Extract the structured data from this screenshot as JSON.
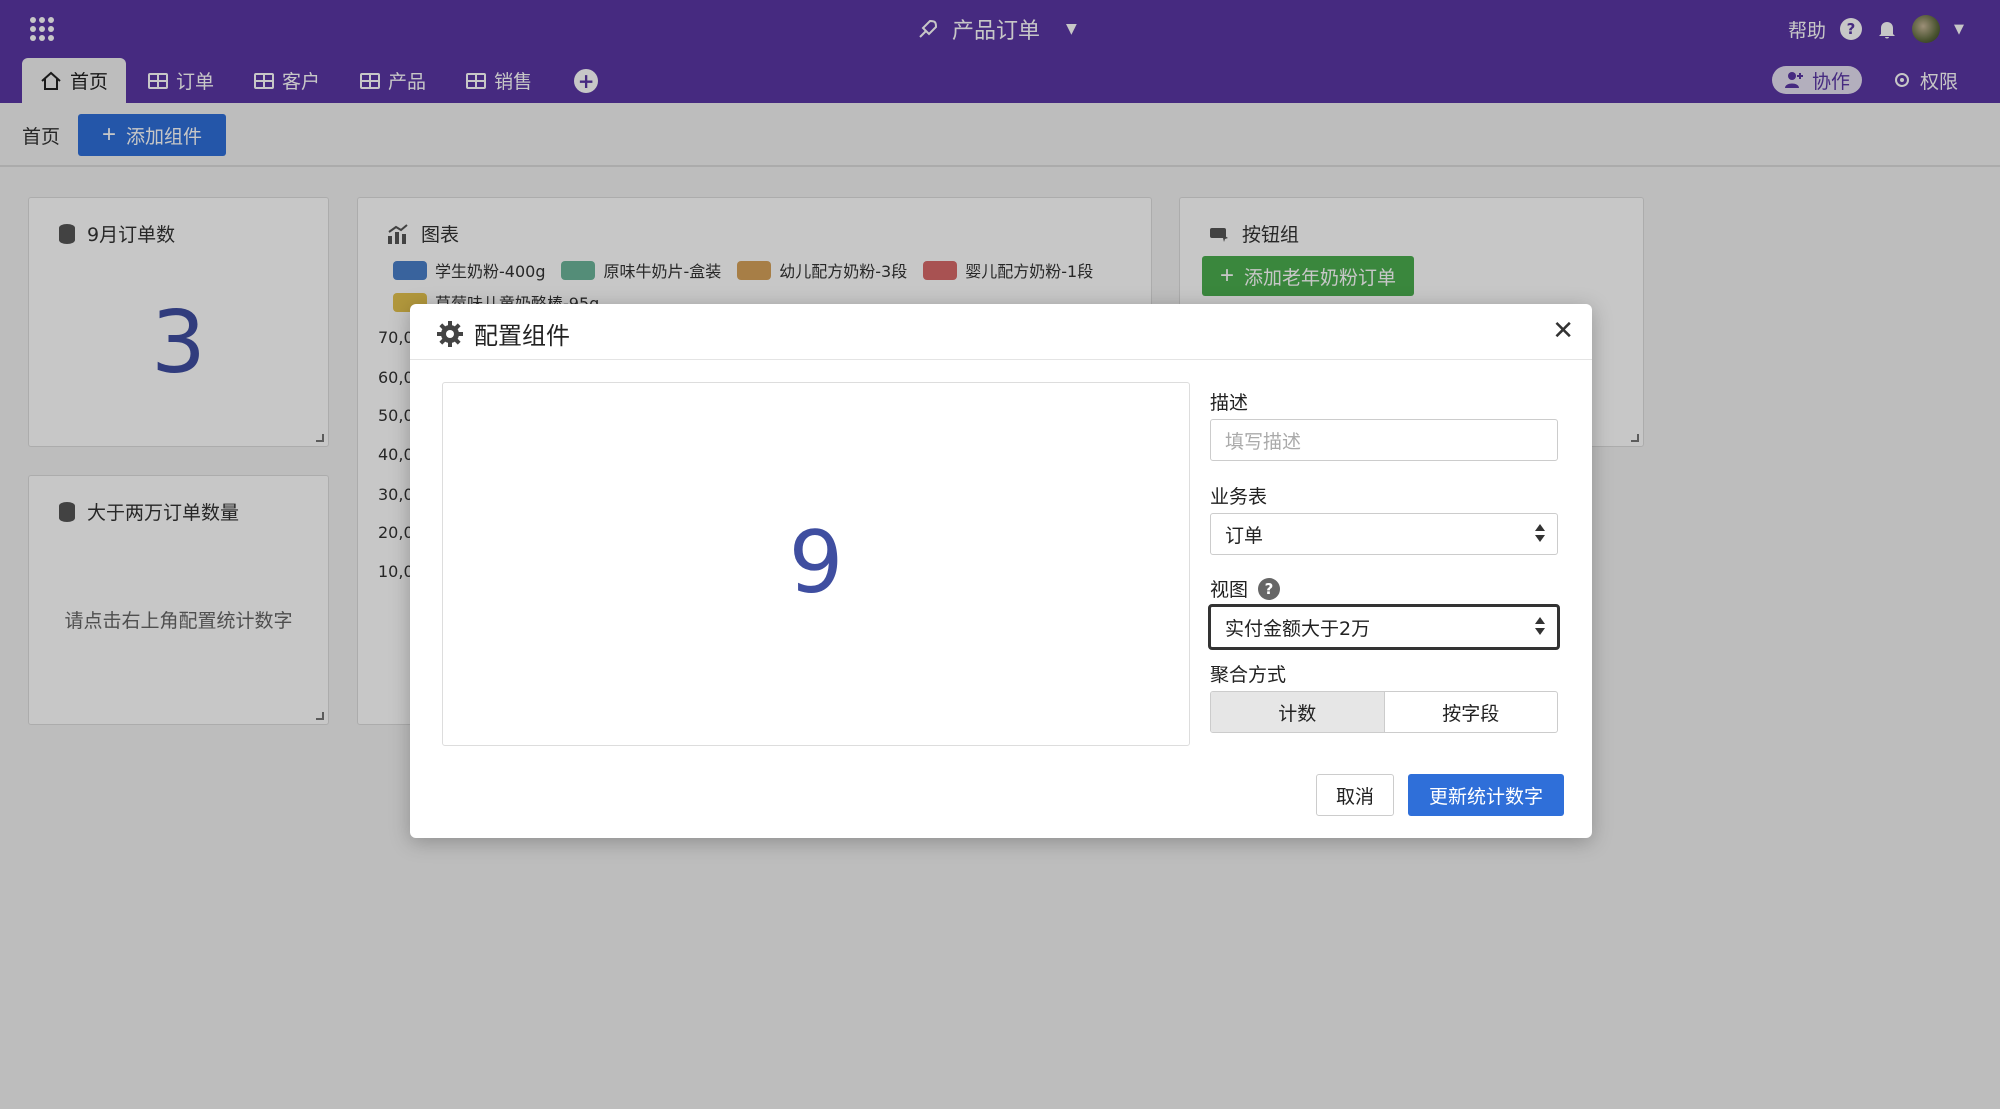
{
  "header": {
    "app_title": "产品订单",
    "help_label": "帮助",
    "tabs": [
      {
        "label": "首页",
        "icon": "home-icon"
      },
      {
        "label": "订单",
        "icon": "table-icon"
      },
      {
        "label": "客户",
        "icon": "table-icon"
      },
      {
        "label": "产品",
        "icon": "table-icon"
      },
      {
        "label": "销售",
        "icon": "table-icon"
      }
    ],
    "collab_label": "协作",
    "perm_label": "权限",
    "brand_color": "#5a36a5"
  },
  "subbar": {
    "breadcrumb": "首页",
    "add_widget_label": "添加组件"
  },
  "widgets": {
    "order_count": {
      "title": "9月订单数",
      "value": "3"
    },
    "big_orders": {
      "title": "大于两万订单数量",
      "hint": "请点击右上角配置统计数字"
    },
    "chart": {
      "title": "图表",
      "legend": [
        {
          "label": "学生奶粉-400g",
          "color": "#4a7fc9"
        },
        {
          "label": "原味牛奶片-盒装",
          "color": "#6cb59a"
        },
        {
          "label": "幼儿配方奶粉-3段",
          "color": "#d6a25a"
        },
        {
          "label": "婴儿配方奶粉-1段",
          "color": "#d86a6a"
        },
        {
          "label": "草莓味儿童奶酪棒-95g",
          "color": "#e3c24e"
        }
      ],
      "yticks": [
        "70,0",
        "60,0",
        "50,0",
        "40,0",
        "30,0",
        "20,0",
        "10,0"
      ]
    },
    "button_group": {
      "title": "按钮组",
      "button_label": "添加老年奶粉订单"
    }
  },
  "modal": {
    "title": "配置组件",
    "preview_value": "9",
    "description_label": "描述",
    "description_placeholder": "填写描述",
    "table_label": "业务表",
    "table_value": "订单",
    "view_label": "视图",
    "view_value": "实付金额大于2万",
    "aggregate_label": "聚合方式",
    "aggregate_options": [
      "计数",
      "按字段"
    ],
    "aggregate_selected": "计数",
    "cancel_label": "取消",
    "submit_label": "更新统计数字"
  }
}
